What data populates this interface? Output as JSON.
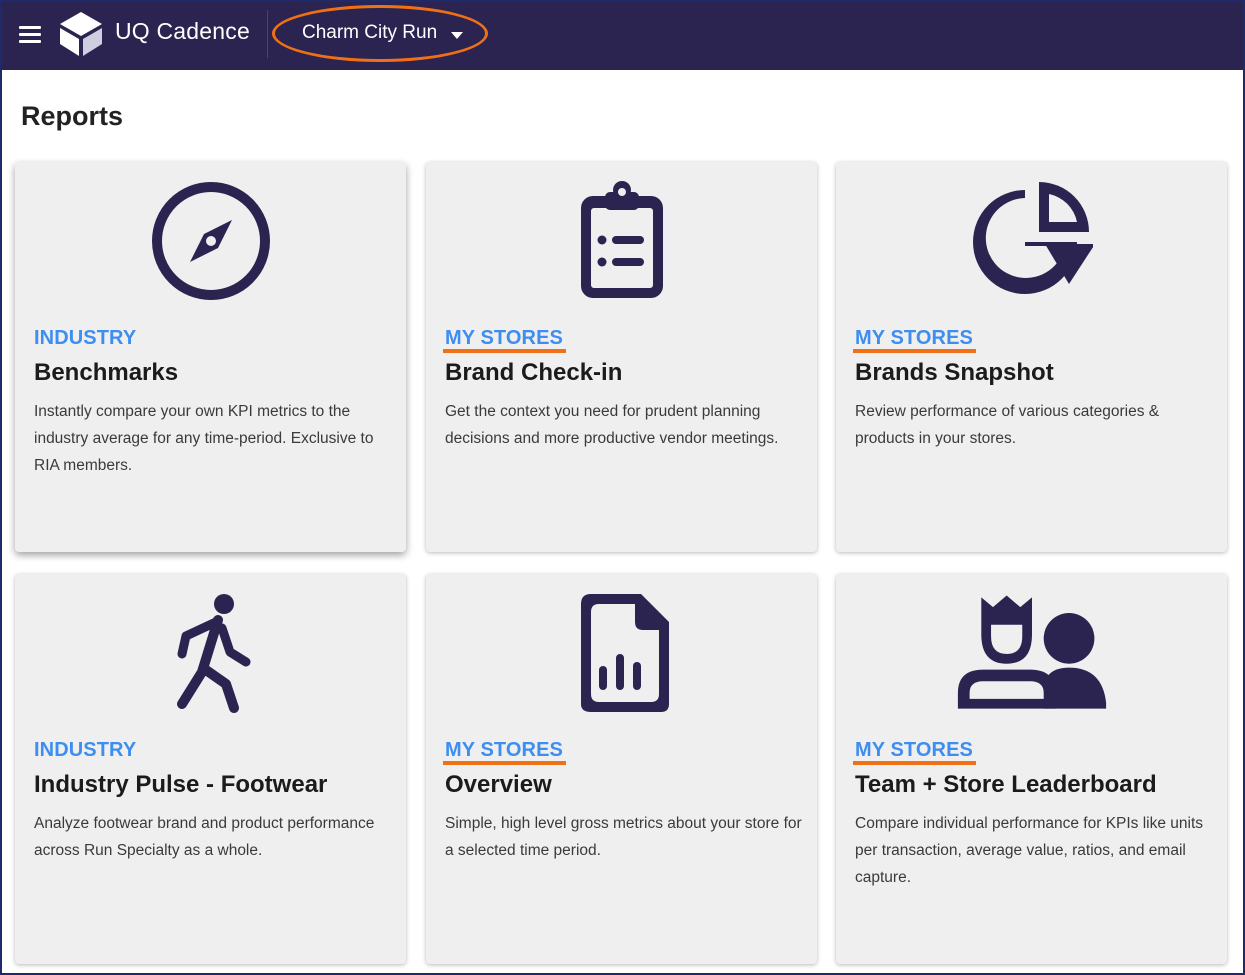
{
  "header": {
    "app_name": "UQ Cadence",
    "store_name": "Charm City Run",
    "menu_icon": "hamburger-menu-icon",
    "logo_icon": "uq-cadence-logo",
    "caret_icon": "caret-down-icon",
    "background_color": "#2b2450"
  },
  "page": {
    "title": "Reports"
  },
  "cards": [
    {
      "icon": "compass-icon",
      "category": "INDUSTRY",
      "title": "Benchmarks",
      "description": "Instantly compare your own KPI metrics to the industry average for any time-period. Exclusive to RIA members."
    },
    {
      "icon": "clipboard-list-icon",
      "category": "MY STORES",
      "title": "Brand Check-in",
      "description": "Get the context you need for prudent planning decisions and more productive vendor meetings."
    },
    {
      "icon": "pie-chart-icon",
      "category": "MY STORES",
      "title": "Brands Snapshot",
      "description": "Review performance of various categories & products in your stores."
    },
    {
      "icon": "walking-person-icon",
      "category": "INDUSTRY",
      "title": "Industry Pulse - Footwear",
      "description": "Analyze footwear brand and product performance across Run Specialty as a whole."
    },
    {
      "icon": "file-chart-icon",
      "category": "MY STORES",
      "title": "Overview",
      "description": "Simple, high level gross metrics about your store for a selected time period."
    },
    {
      "icon": "leaderboard-people-icon",
      "category": "MY STORES",
      "title": "Team + Store Leaderboard",
      "description": "Compare individual performance for KPIs like units per transaction, average value, ratios, and email capture."
    }
  ],
  "colors": {
    "icon": "#2b2450",
    "category": "#3d8ef0",
    "annotation": "#f07016",
    "card_background": "#efefef"
  }
}
